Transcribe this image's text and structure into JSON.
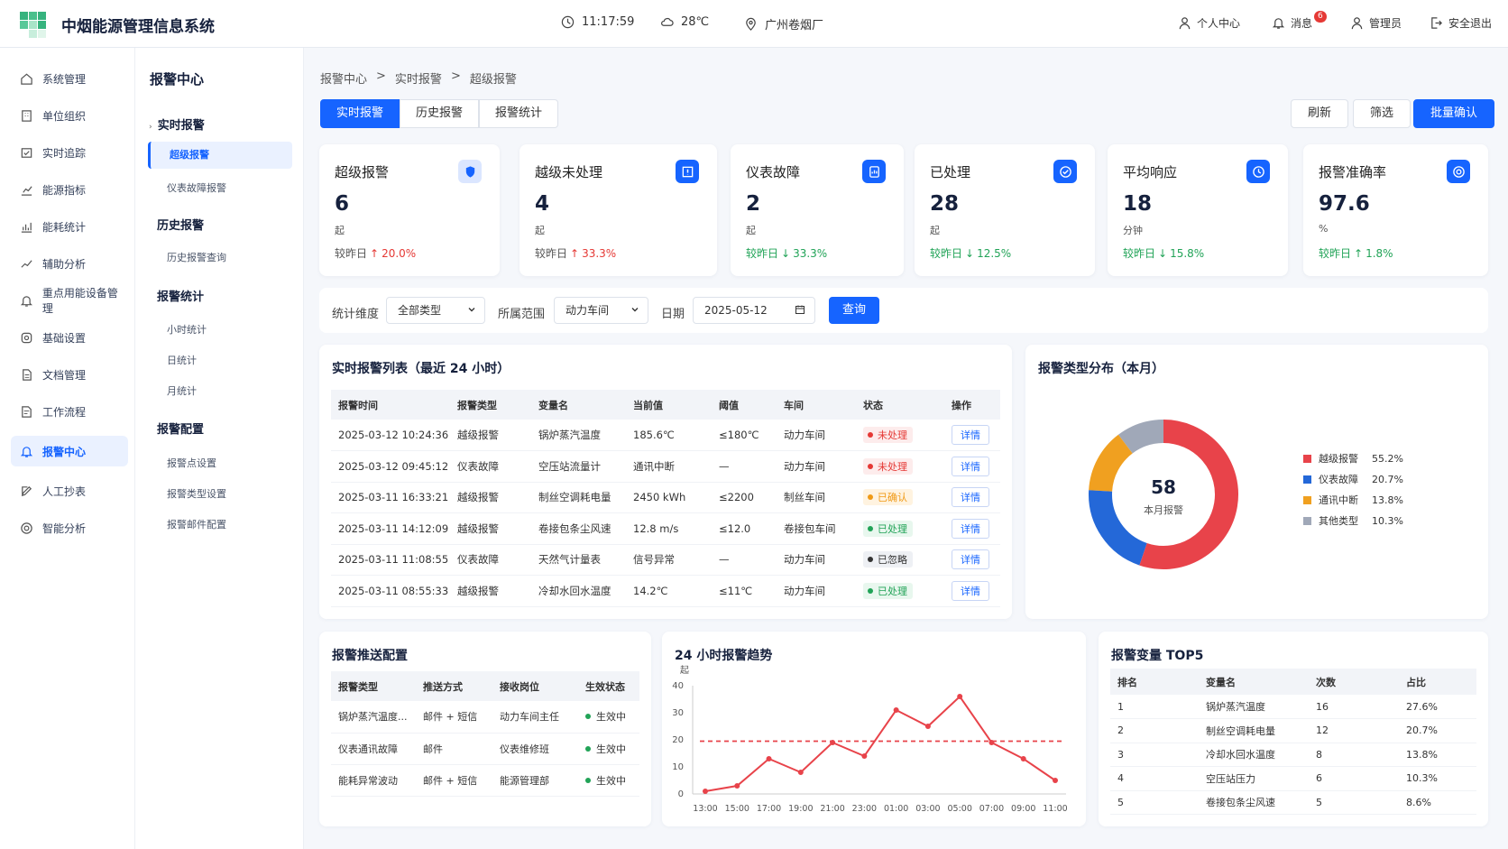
{
  "app": {
    "title": "中烟能源管理信息系统"
  },
  "header": {
    "time": "11:17:59",
    "temp": "28℃",
    "location": "广州卷烟厂",
    "personal": "个人中心",
    "messages": "消息",
    "msg_count": "6",
    "user": "管理员",
    "logout": "安全退出"
  },
  "sidebar": {
    "items": [
      {
        "label": "系统管理",
        "icon": "home-icon"
      },
      {
        "label": "单位组织",
        "icon": "building-icon"
      },
      {
        "label": "实时追踪",
        "icon": "track-icon"
      },
      {
        "label": "能源指标",
        "icon": "chart-icon"
      },
      {
        "label": "能耗统计",
        "icon": "stats-icon"
      },
      {
        "label": "辅助分析",
        "icon": "trend-icon"
      },
      {
        "label": "重点用能设备管理",
        "icon": "bell-icon"
      },
      {
        "label": "基础设置",
        "icon": "gear-icon"
      },
      {
        "label": "文档管理",
        "icon": "doc-icon"
      },
      {
        "label": "工作流程",
        "icon": "flow-icon"
      },
      {
        "label": "报警中心",
        "icon": "bell-icon",
        "active": true
      },
      {
        "label": "人工抄表",
        "icon": "edit-icon"
      },
      {
        "label": "智能分析",
        "icon": "target-icon"
      }
    ]
  },
  "subnav": {
    "title": "报警中心",
    "g1": "实时报警",
    "g1a": "超级报警",
    "g1b": "仪表故障报警",
    "g2": "历史报警",
    "g2a": "历史报警查询",
    "g3": "报警统计",
    "g3a": "小时统计",
    "g3b": "日统计",
    "g3c": "月统计",
    "g4": "报警配置",
    "g4a": "报警点设置",
    "g4b": "报警类型设置",
    "g4c": "报警邮件配置"
  },
  "breadcrumb": {
    "a": "报警中心",
    "b": "实时报警",
    "c": "超级报警",
    "sep": ">"
  },
  "tabs": [
    "实时报警",
    "历史报警",
    "报警统计"
  ],
  "actions": {
    "refresh": "刷新",
    "filter": "筛选",
    "batch": "批量确认"
  },
  "cards": [
    {
      "title": "超级报警",
      "value": "6",
      "unit": "起",
      "cmp_label": "较昨日",
      "arrow": "↑",
      "cmp": "20.0%",
      "dir": "up",
      "icon": "shield-icon"
    },
    {
      "title": "越级未处理",
      "value": "4",
      "unit": "起",
      "cmp_label": "较昨日",
      "arrow": "↑",
      "cmp": "33.3%",
      "dir": "up",
      "icon": "alert-box-icon"
    },
    {
      "title": "仪表故障",
      "value": "2",
      "unit": "起",
      "cmp_label": "较昨日",
      "arrow": "↓",
      "cmp": "33.3%",
      "dir": "down",
      "icon": "meter-icon"
    },
    {
      "title": "已处理",
      "value": "28",
      "unit": "起",
      "cmp_label": "较昨日",
      "arrow": "↓",
      "cmp": "12.5%",
      "dir": "down",
      "icon": "check-icon"
    },
    {
      "title": "平均响应",
      "value": "18",
      "unit": "分钟",
      "cmp_label": "较昨日",
      "arrow": "↓",
      "cmp": "15.8%",
      "dir": "down",
      "icon": "clock-icon"
    },
    {
      "title": "报警准确率",
      "value": "97.6",
      "unit": "%",
      "cmp_label": "较昨日",
      "arrow": "↑",
      "cmp": "1.8%",
      "dir": "down",
      "icon": "target-icon"
    }
  ],
  "filter": {
    "dim_label": "统计维度",
    "dim_value": "全部类型",
    "scope_label": "所属范围",
    "scope_value": "动力车间",
    "date_label": "日期",
    "date_value": "2025-05-12",
    "query": "查询"
  },
  "alarm_table": {
    "title": "实时报警列表（最近 24 小时）",
    "headers": [
      "报警时间",
      "报警类型",
      "变量名",
      "当前值",
      "阈值",
      "车间",
      "状态",
      "操作"
    ],
    "rows": [
      [
        "2025-03-12 10:24:36",
        "越级报警",
        "锅炉蒸汽温度",
        "185.6℃",
        "≤180℃",
        "动力车间",
        "未处理",
        "详情",
        "red"
      ],
      [
        "2025-03-12 09:45:12",
        "仪表故障",
        "空压站流量计",
        "通讯中断",
        "—",
        "动力车间",
        "未处理",
        "详情",
        "red"
      ],
      [
        "2025-03-11 16:33:21",
        "越级报警",
        "制丝空调耗电量",
        "2450 kWh",
        "≤2200",
        "制丝车间",
        "已确认",
        "详情",
        "orange"
      ],
      [
        "2025-03-11 14:12:09",
        "越级报警",
        "卷接包条尘风速",
        "12.8 m/s",
        "≤12.0",
        "卷接包车间",
        "已处理",
        "详情",
        "green"
      ],
      [
        "2025-03-11 11:08:55",
        "仪表故障",
        "天然气计量表",
        "信号异常",
        "—",
        "动力车间",
        "已忽略",
        "详情",
        "gray"
      ],
      [
        "2025-03-11 08:55:33",
        "越级报警",
        "冷却水回水温度",
        "14.2℃",
        "≤11℃",
        "动力车间",
        "已处理",
        "详情",
        "green"
      ]
    ]
  },
  "donut": {
    "title": "报警类型分布（本月）",
    "total": "58",
    "total_label": "本月报警",
    "items": [
      {
        "name": "越级报警",
        "pct": "55.2%",
        "value": 55.2,
        "color": "#e8434a"
      },
      {
        "name": "仪表故障",
        "pct": "20.7%",
        "value": 20.7,
        "color": "#2468d8"
      },
      {
        "name": "通讯中断",
        "pct": "13.8%",
        "value": 13.8,
        "color": "#f0a020"
      },
      {
        "name": "其他类型",
        "pct": "10.3%",
        "value": 10.3,
        "color": "#a0a8b8"
      }
    ]
  },
  "push": {
    "title": "报警推送配置",
    "headers": [
      "报警类型",
      "推送方式",
      "接收岗位",
      "生效状态"
    ],
    "rows": [
      [
        "锅炉蒸汽温度...",
        "邮件 + 短信",
        "动力车间主任",
        "生效中"
      ],
      [
        "仪表通讯故障",
        "邮件",
        "仪表维修班",
        "生效中"
      ],
      [
        "能耗异常波动",
        "邮件 + 短信",
        "能源管理部",
        "生效中"
      ]
    ]
  },
  "chart_data": {
    "type": "line",
    "title": "24 小时报警趋势",
    "ylabel": "起",
    "x": [
      "13:00",
      "15:00",
      "17:00",
      "19:00",
      "21:00",
      "23:00",
      "01:00",
      "03:00",
      "05:00",
      "07:00",
      "09:00",
      "11:00"
    ],
    "y_ticks": [
      "0",
      "10",
      "20",
      "30",
      "40"
    ],
    "ylim": [
      0,
      40
    ],
    "series": [
      {
        "values": [
          1,
          3,
          13,
          8,
          19,
          14,
          31,
          25,
          36,
          19,
          13,
          5
        ],
        "color": "#e8434a"
      }
    ],
    "threshold": 19.5,
    "grid": false
  },
  "top5": {
    "title": "报警变量 TOP5",
    "headers": [
      "排名",
      "变量名",
      "次数",
      "占比"
    ],
    "rows": [
      [
        "1",
        "锅炉蒸汽温度",
        "16",
        "27.6%"
      ],
      [
        "2",
        "制丝空调耗电量",
        "12",
        "20.7%"
      ],
      [
        "3",
        "冷却水回水温度",
        "8",
        "13.8%"
      ],
      [
        "4",
        "空压站压力",
        "6",
        "10.3%"
      ],
      [
        "5",
        "卷接包条尘风速",
        "5",
        "8.6%"
      ]
    ]
  }
}
